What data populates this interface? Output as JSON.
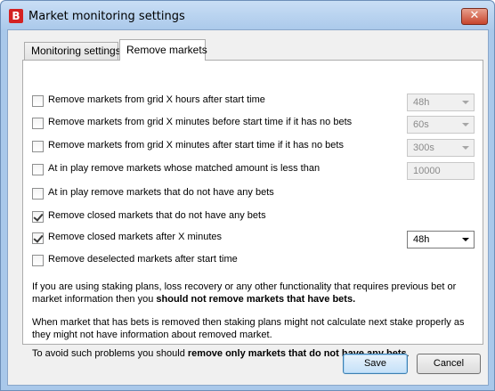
{
  "window": {
    "app_icon_letter": "B",
    "title": "Market monitoring settings",
    "close_glyph": "✕"
  },
  "tabs": [
    {
      "label": "Monitoring settings",
      "active": false
    },
    {
      "label": "Remove markets",
      "active": true
    }
  ],
  "options": [
    {
      "label": "Remove markets from grid X hours after start time",
      "checked": false,
      "control": {
        "type": "dropdown",
        "value": "48h",
        "enabled": false
      }
    },
    {
      "label": "Remove markets from grid X minutes before start time if it has no bets",
      "checked": false,
      "control": {
        "type": "dropdown",
        "value": "60s",
        "enabled": false
      }
    },
    {
      "label": "Remove markets from grid X minutes after start time if it has no bets",
      "checked": false,
      "control": {
        "type": "dropdown",
        "value": "300s",
        "enabled": false
      }
    },
    {
      "label": "At in play remove markets whose matched amount is less than",
      "checked": false,
      "control": {
        "type": "textbox",
        "value": "10000",
        "enabled": false
      }
    },
    {
      "label": "At in play remove markets that do not have any bets",
      "checked": false
    },
    {
      "label": "Remove closed markets that do not have any bets",
      "checked": true
    },
    {
      "label": "Remove closed markets after X minutes",
      "checked": true,
      "control": {
        "type": "dropdown",
        "value": "48h",
        "enabled": true
      }
    },
    {
      "label": "Remove deselected markets after start time",
      "checked": false
    }
  ],
  "info": {
    "p1_text": "If you are using staking plans, loss recovery or any other functionality that requires previous bet or market information then you ",
    "p1_bold": "should not remove markets that have bets.",
    "p2_text": "When market that has bets is removed then staking plans might not calculate next stake properly as they might not have information about removed market.",
    "p3_text": "To avoid such problems you should ",
    "p3_bold": "remove only markets that do not have any bets",
    "p3_end": "."
  },
  "buttons": {
    "save": "Save",
    "cancel": "Cancel"
  }
}
